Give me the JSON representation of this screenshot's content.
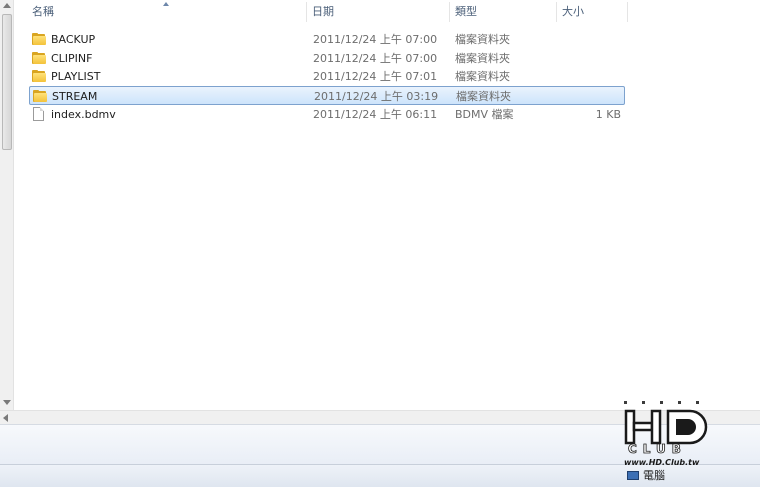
{
  "columns": {
    "name": "名稱",
    "date": "日期",
    "type": "類型",
    "size": "大小"
  },
  "files": [
    {
      "name": "BACKUP",
      "date": "2011/12/24 上午 07:00",
      "type": "檔案資料夾",
      "size": "",
      "icon": "folder-icon",
      "selected": false
    },
    {
      "name": "CLIPINF",
      "date": "2011/12/24 上午 07:00",
      "type": "檔案資料夾",
      "size": "",
      "icon": "folder-icon",
      "selected": false
    },
    {
      "name": "PLAYLIST",
      "date": "2011/12/24 上午 07:01",
      "type": "檔案資料夾",
      "size": "",
      "icon": "folder-icon",
      "selected": false
    },
    {
      "name": "STREAM",
      "date": "2011/12/24 上午 03:19",
      "type": "檔案資料夾",
      "size": "",
      "icon": "folder-icon",
      "selected": true
    },
    {
      "name": "index.bdmv",
      "date": "2011/12/24 上午 06:11",
      "type": "BDMV 檔案",
      "size": "1 KB",
      "icon": "file-icon",
      "selected": false
    }
  ],
  "status": {
    "location": "電腦"
  },
  "watermark": {
    "brand": "HD CLUB",
    "site": "www.HD.Club.tw"
  },
  "colors": {
    "header_text": "#4c607a",
    "selection_border": "#7da2ce",
    "folder": "#f3c23a"
  }
}
